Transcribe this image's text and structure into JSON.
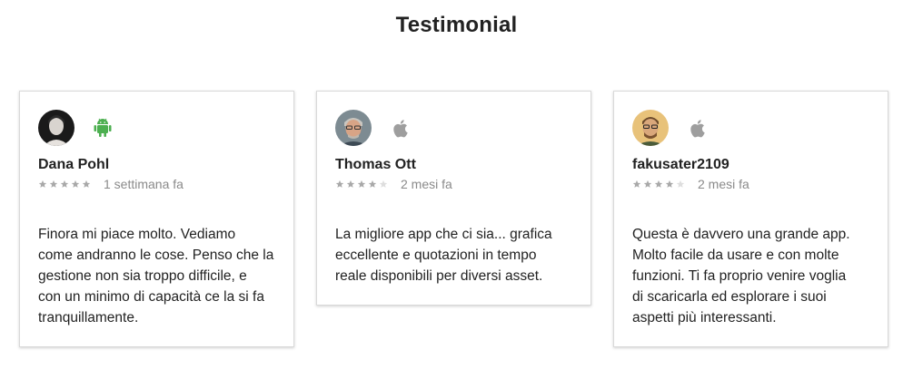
{
  "header": {
    "title": "Testimonial"
  },
  "colors": {
    "android": "#4caf50",
    "apple": "#9e9e9e",
    "star_filled": "#a9a9a9",
    "star_empty": "#dedede"
  },
  "testimonials": [
    {
      "name": "Dana Pohl",
      "platform_icon": "android-icon",
      "rating": 5,
      "max_rating": 5,
      "time": "1 settimana fa",
      "text": "Finora mi piace molto. Vediamo\ncome andranno le cose. Penso che la\ngestione non sia troppo difficile, e\ncon un minimo di capacità ce la si fa\ntranquillamente."
    },
    {
      "name": "Thomas Ott",
      "platform_icon": "apple-icon",
      "rating": 4,
      "max_rating": 5,
      "time": "2 mesi fa",
      "text": "La migliore app che ci sia... grafica\neccellente e quotazioni in tempo\nreale disponibili per diversi asset."
    },
    {
      "name": "fakusater2109",
      "platform_icon": "apple-icon",
      "rating": 4,
      "max_rating": 5,
      "time": "2 mesi fa",
      "text": "Questa è davvero una grande app.\nMolto facile da usare e con molte\nfunzioni. Ti fa proprio venire voglia\ndi scaricarla ed esplorare i suoi\naspetti più interessanti."
    }
  ]
}
